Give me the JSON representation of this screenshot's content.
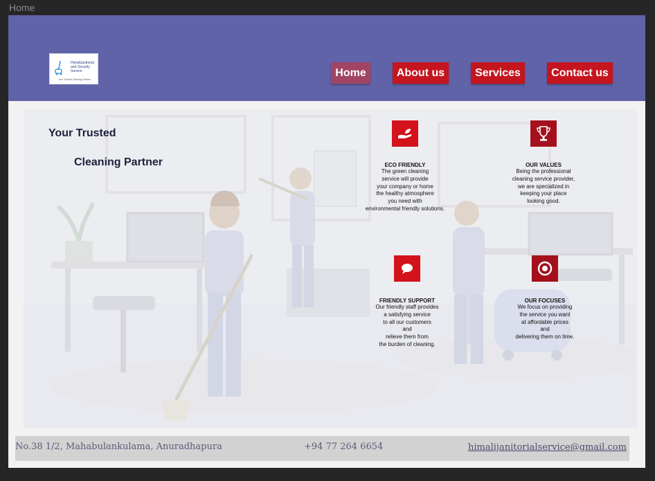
{
  "tab": {
    "title": "Home"
  },
  "logo": {
    "name_lines": "HimaliJanitorial and Security Service",
    "tagline": "Your Trusted Cleaning Partner",
    "icon": "vacuum-cleaner-icon"
  },
  "nav": {
    "items": [
      {
        "label": "Home",
        "active": true
      },
      {
        "label": "About us",
        "active": false
      },
      {
        "label": "Services",
        "active": false
      },
      {
        "label": "Contact us",
        "active": false
      }
    ]
  },
  "hero": {
    "tagline_line1": "Your Trusted",
    "tagline_line2": "Cleaning Partner"
  },
  "features": [
    {
      "icon": "hand-leaf-icon",
      "title": "ECO FRIENDLY",
      "body": "The green cleaning\nservice will provide\nyour company or home\nthe healthy atmosphere\nyou need with\nenvironmental friendly solutions."
    },
    {
      "icon": "trophy-icon",
      "title": "OUR VALUES",
      "body": "Being the professional\ncleaning service provider,\nwe are specialized in\nkeeping your place\nlooking good."
    },
    {
      "icon": "chat-bubble-icon",
      "title": "FRIENDLY SUPPORT",
      "body": "Our friendly staff provides\na satisfying service\nto all our customers\nand\nrelieve them from\nthe burden of cleaning."
    },
    {
      "icon": "target-icon",
      "title": "OUR FOCUSES",
      "body": "We focus on providing\nthe service you want\nat affordable prices\nand\ndelivering them on time."
    }
  ],
  "footer": {
    "address": "No.38 1/2, Mahabulankulama, Anuradhapura",
    "phone": "+94 77 264 6654",
    "email": "himalijanitorialservice@gmail.com"
  },
  "colors": {
    "navbar": "#6163a8",
    "button": "#c5151f",
    "button_active": "#a24463",
    "icon_tile": "#d3121b"
  }
}
